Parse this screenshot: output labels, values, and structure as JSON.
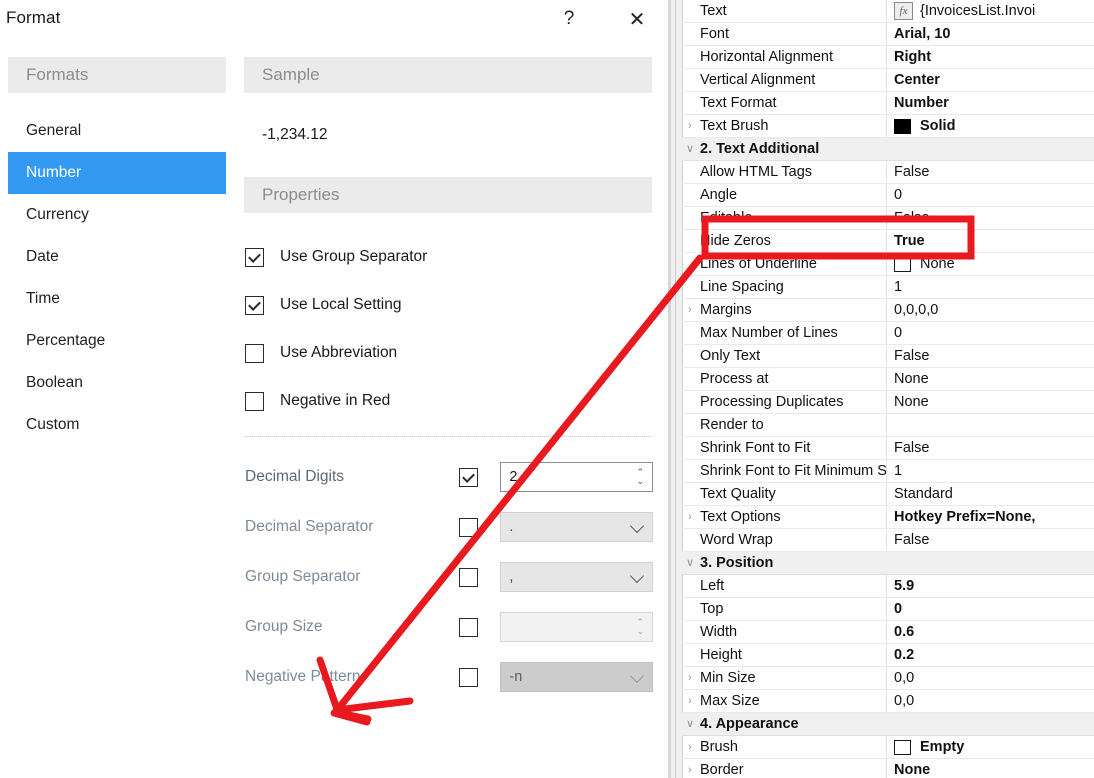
{
  "dialog": {
    "title": "Format",
    "help_label": "?",
    "close_label": "✕",
    "formats_header": "Formats",
    "sample_header": "Sample",
    "properties_header": "Properties",
    "sample_value": "-1,234.12",
    "selected_format": "Number",
    "accent_color": "#3399f3",
    "header_bg": "#ebebeb",
    "formats": [
      {
        "label": "General",
        "selected": false
      },
      {
        "label": "Number",
        "selected": true
      },
      {
        "label": "Currency",
        "selected": false
      },
      {
        "label": "Date",
        "selected": false
      },
      {
        "label": "Time",
        "selected": false
      },
      {
        "label": "Percentage",
        "selected": false
      },
      {
        "label": "Boolean",
        "selected": false
      },
      {
        "label": "Custom",
        "selected": false
      }
    ],
    "checkboxes": [
      {
        "label": "Use Group Separator",
        "checked": true
      },
      {
        "label": "Use Local Setting",
        "checked": true
      },
      {
        "label": "Use Abbreviation",
        "checked": false
      },
      {
        "label": "Negative in Red",
        "checked": false
      }
    ],
    "fields": [
      {
        "label": "Decimal Digits",
        "checked": true,
        "value": "2",
        "control": "spinner",
        "enabled": true
      },
      {
        "label": "Decimal Separator",
        "checked": false,
        "value": ".",
        "control": "combo",
        "enabled": false
      },
      {
        "label": "Group Separator",
        "checked": false,
        "value": ",",
        "control": "combo",
        "enabled": false
      },
      {
        "label": "Group Size",
        "checked": false,
        "value": "",
        "control": "spinner",
        "enabled": false
      },
      {
        "label": "Negative Pattern",
        "checked": false,
        "value": "-n",
        "control": "combo",
        "enabled": false,
        "dark": true
      }
    ]
  },
  "properties": {
    "highlight_color": "#e8191f",
    "highlighted_row": "Hide Zeros",
    "rows": [
      {
        "name": "Text",
        "value": "{InvoicesList.Invoi",
        "bold": false,
        "expand": "",
        "icon": "fx",
        "category": false
      },
      {
        "name": "Font",
        "value": "Arial, 10",
        "bold": true,
        "expand": "",
        "category": false
      },
      {
        "name": "Horizontal Alignment",
        "value": "Right",
        "bold": true,
        "expand": "",
        "category": false
      },
      {
        "name": "Vertical Alignment",
        "value": "Center",
        "bold": true,
        "expand": "",
        "category": false
      },
      {
        "name": "Text Format",
        "value": "Number",
        "bold": true,
        "expand": "",
        "category": false
      },
      {
        "name": "Text Brush",
        "value": "Solid",
        "bold": true,
        "expand": "›",
        "icon": "black-swatch",
        "category": false
      },
      {
        "name": "2. Text  Additional",
        "value": "",
        "bold": true,
        "expand": "∨",
        "category": true
      },
      {
        "name": "Allow HTML Tags",
        "value": "False",
        "bold": false,
        "expand": "",
        "category": false
      },
      {
        "name": "Angle",
        "value": "0",
        "bold": false,
        "expand": "",
        "category": false
      },
      {
        "name": "Editable",
        "value": "False",
        "bold": false,
        "expand": "",
        "category": false
      },
      {
        "name": "Hide Zeros",
        "value": "True",
        "bold": true,
        "expand": "",
        "category": false
      },
      {
        "name": "Lines of Underline",
        "value": "None",
        "bold": false,
        "expand": "",
        "icon": "empty-swatch",
        "category": false
      },
      {
        "name": "Line Spacing",
        "value": "1",
        "bold": false,
        "expand": "",
        "category": false
      },
      {
        "name": "Margins",
        "value": "0,0,0,0",
        "bold": false,
        "expand": "›",
        "category": false
      },
      {
        "name": "Max Number of Lines",
        "value": "0",
        "bold": false,
        "expand": "",
        "category": false
      },
      {
        "name": "Only Text",
        "value": "False",
        "bold": false,
        "expand": "",
        "category": false
      },
      {
        "name": "Process at",
        "value": "None",
        "bold": false,
        "expand": "",
        "category": false
      },
      {
        "name": "Processing Duplicates",
        "value": "None",
        "bold": false,
        "expand": "",
        "category": false
      },
      {
        "name": "Render to",
        "value": "",
        "bold": false,
        "expand": "",
        "category": false
      },
      {
        "name": "Shrink Font to Fit",
        "value": "False",
        "bold": false,
        "expand": "",
        "category": false
      },
      {
        "name": "Shrink Font to Fit Minimum Si",
        "value": "1",
        "bold": false,
        "expand": "",
        "category": false
      },
      {
        "name": "Text Quality",
        "value": "Standard",
        "bold": false,
        "expand": "",
        "category": false
      },
      {
        "name": "Text Options",
        "value": "Hotkey Prefix=None,",
        "bold": true,
        "expand": "›",
        "category": false
      },
      {
        "name": "Word Wrap",
        "value": "False",
        "bold": false,
        "expand": "",
        "category": false
      },
      {
        "name": "3. Position",
        "value": "",
        "bold": true,
        "expand": "∨",
        "category": true
      },
      {
        "name": "Left",
        "value": "5.9",
        "bold": true,
        "expand": "",
        "category": false
      },
      {
        "name": "Top",
        "value": "0",
        "bold": true,
        "expand": "",
        "category": false
      },
      {
        "name": "Width",
        "value": "0.6",
        "bold": true,
        "expand": "",
        "category": false
      },
      {
        "name": "Height",
        "value": "0.2",
        "bold": true,
        "expand": "",
        "category": false
      },
      {
        "name": "Min Size",
        "value": "0,0",
        "bold": false,
        "expand": "›",
        "category": false
      },
      {
        "name": "Max Size",
        "value": "0,0",
        "bold": false,
        "expand": "›",
        "category": false
      },
      {
        "name": "4. Appearance",
        "value": "",
        "bold": true,
        "expand": "∨",
        "category": true
      },
      {
        "name": "Brush",
        "value": "Empty",
        "bold": true,
        "expand": "›",
        "icon": "empty-swatch",
        "category": false
      },
      {
        "name": "Border",
        "value": "None",
        "bold": true,
        "expand": "›",
        "category": false
      }
    ]
  }
}
